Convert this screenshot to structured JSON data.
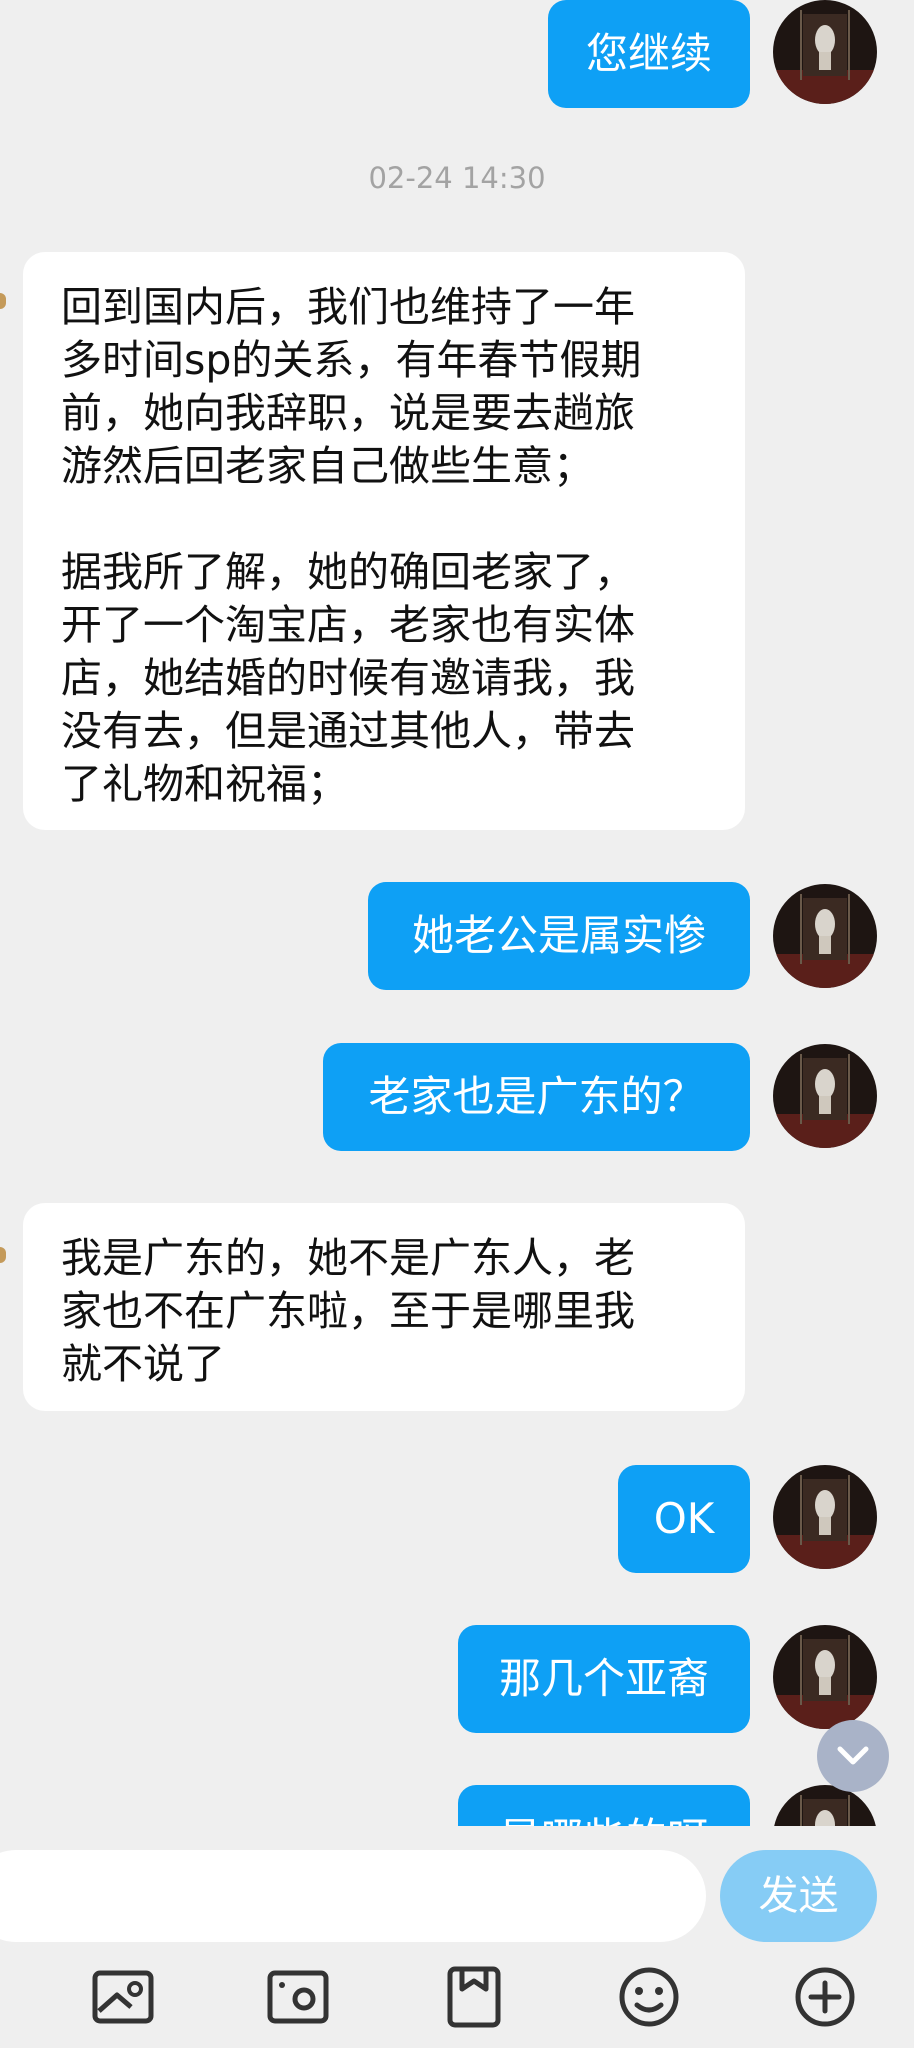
{
  "timestamp": "02-24 14:30",
  "messages": [
    {
      "dir": "out",
      "text": "您继续"
    },
    {
      "dir": "in",
      "paragraphs": [
        "回到国内后，我们也维持了一年\n多时间sp的关系，有年春节假期\n前，她向我辞职，说是要去趟旅\n游然后回老家自己做些生意；",
        "据我所了解，她的确回老家了，\n开了一个淘宝店，老家也有实体\n店，她结婚的时候有邀请我，我\n没有去，但是通过其他人，带去\n了礼物和祝福；"
      ]
    },
    {
      "dir": "out",
      "text": "她老公是属实惨"
    },
    {
      "dir": "out",
      "text": "老家也是广东的？"
    },
    {
      "dir": "in",
      "paragraphs": [
        "我是广东的，她不是广东人，老\n家也不在广东啦，至于是哪里我\n就不说了"
      ]
    },
    {
      "dir": "out",
      "text": "OK"
    },
    {
      "dir": "out",
      "text": "那几个亚裔"
    },
    {
      "dir": "out",
      "text": "是哪些的呀"
    }
  ],
  "input": {
    "value": "",
    "send_label": "发送"
  },
  "toolbar": [
    "image-icon",
    "camera-icon",
    "file-icon",
    "emoji-icon",
    "plus-icon"
  ],
  "colors": {
    "bubble_out": "#0ea0f5",
    "bubble_in": "#ffffff",
    "background": "#efefef",
    "send": "#86ccf5"
  }
}
